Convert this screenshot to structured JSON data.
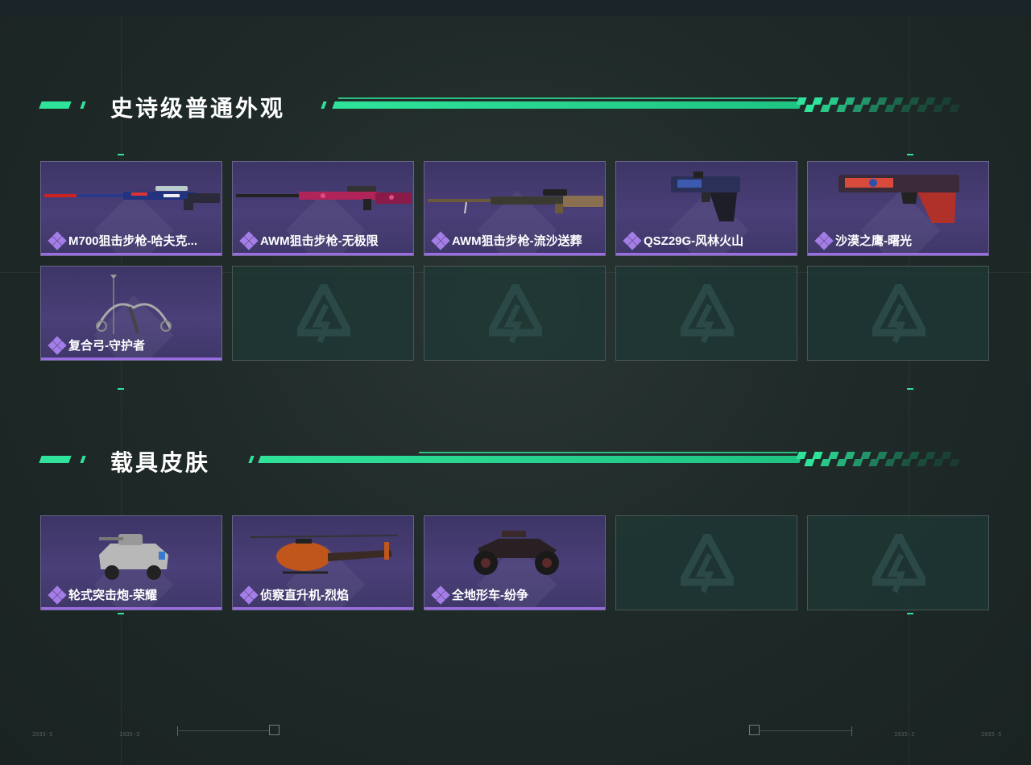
{
  "colors": {
    "accent_green": "#2fe39a",
    "epic_purple": "#9a6ee0",
    "card_bg": "#443a70",
    "empty_bg": "#1e3836"
  },
  "sections": [
    {
      "title": "史诗级普通外观",
      "items": [
        {
          "name": "M700狙击步枪-哈夫克...",
          "icon": "sniper-rifle-icon"
        },
        {
          "name": "AWM狙击步枪-无极限",
          "icon": "sniper-rifle-icon"
        },
        {
          "name": "AWM狙击步枪-流沙送葬",
          "icon": "sniper-rifle-icon"
        },
        {
          "name": "QSZ29G-风林火山",
          "icon": "pistol-icon"
        },
        {
          "name": "沙漠之鹰-曙光",
          "icon": "pistol-icon"
        },
        {
          "name": "复合弓-守护者",
          "icon": "compound-bow-icon"
        }
      ],
      "empty_slots": 4
    },
    {
      "title": "载具皮肤",
      "items": [
        {
          "name": "轮式突击炮-荣耀",
          "icon": "armored-vehicle-icon"
        },
        {
          "name": "侦察直升机-烈焰",
          "icon": "helicopter-icon"
        },
        {
          "name": "全地形车-纷争",
          "icon": "atv-icon"
        }
      ],
      "empty_slots": 2
    }
  ],
  "footer": {
    "left_code_1": "2035-5",
    "left_code_2": "1935-3",
    "right_code_1": "1935-3",
    "right_code_2": "2035-5"
  }
}
